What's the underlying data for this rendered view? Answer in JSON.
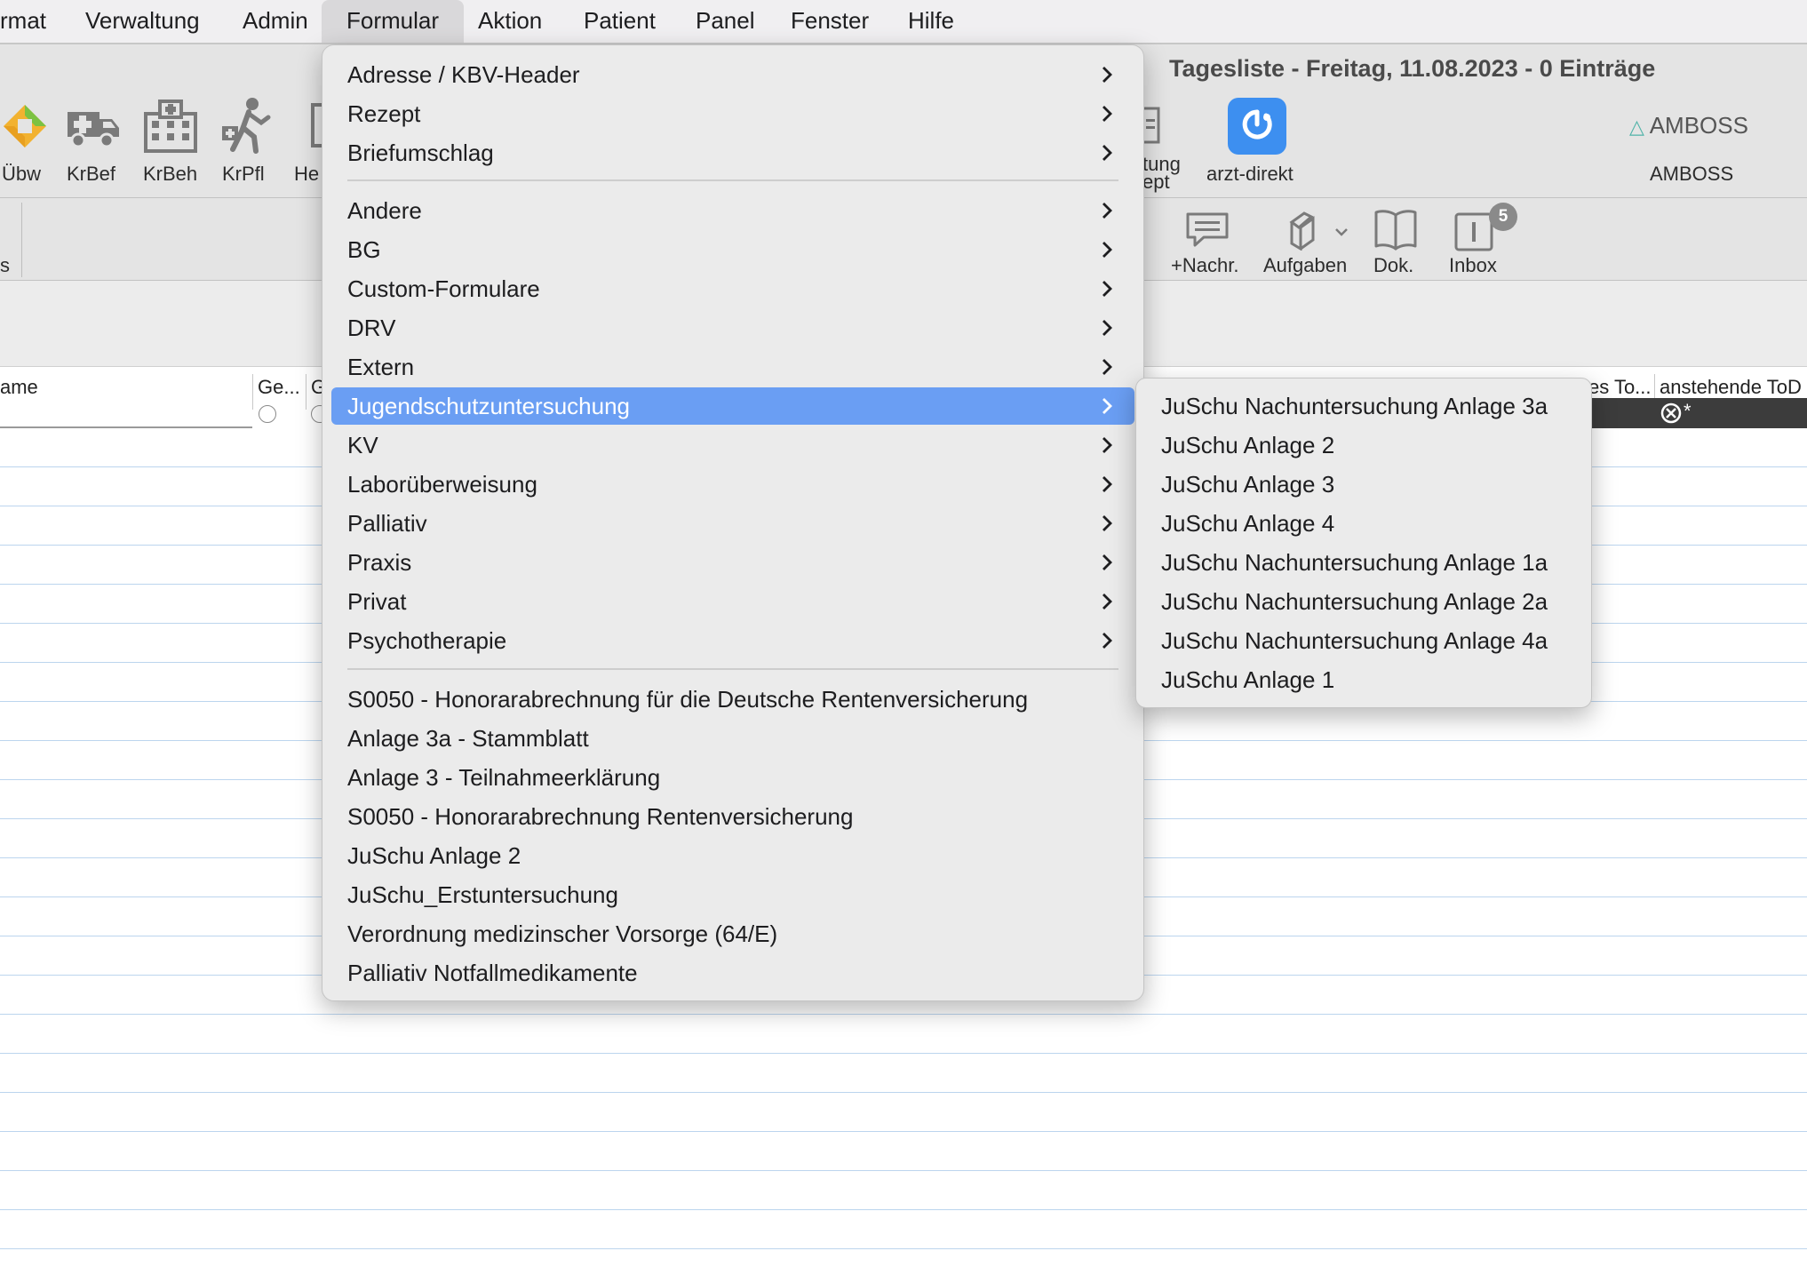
{
  "menubar": {
    "items": [
      "rmat",
      "Verwaltung",
      "Admin",
      "Formular",
      "Aktion",
      "Patient",
      "Panel",
      "Fenster",
      "Hilfe"
    ],
    "active": "Formular"
  },
  "window": {
    "title": "Tagesliste - Freitag, 11.08.2023 - 0 Einträge"
  },
  "toolbar": {
    "left_buttons": [
      "Übw",
      "KrBef",
      "KrBeh",
      "KrPfl",
      "He"
    ],
    "partial_label_1": "tung",
    "partial_label_2": "ept",
    "arzt_direkt": "arzt-direkt",
    "amboss_logo": "AMBOSS",
    "amboss_label": "AMBOSS",
    "row2_left": "s",
    "nachr": "+Nachr.",
    "aufgaben": "Aufgaben",
    "dok": "Dok.",
    "inbox": "Inbox",
    "inbox_badge": "5"
  },
  "table": {
    "headers": [
      "ame",
      "Ge...",
      "G",
      "es To...",
      "anstehende ToD"
    ],
    "todo_cell": "*"
  },
  "formular_menu": {
    "group1": [
      "Adresse / KBV-Header",
      "Rezept",
      "Briefumschlag"
    ],
    "group2": [
      "Andere",
      "BG",
      "Custom-Formulare",
      "DRV",
      "Extern",
      "Jugendschutzuntersuchung",
      "KV",
      "Laborüberweisung",
      "Palliativ",
      "Praxis",
      "Privat",
      "Psychotherapie"
    ],
    "highlighted": "Jugendschutzuntersuchung",
    "group3": [
      "S0050 - Honorarabrechnung für die Deutsche Rentenversicherung",
      "Anlage 3a - Stammblatt",
      "Anlage 3 - Teilnahmeerklärung",
      "S0050 - Honorarabrechnung Rentenversicherung",
      "JuSchu Anlage 2",
      "JuSchu_Erstuntersuchung",
      "Verordnung medizinscher Vorsorge (64/E)",
      "Palliativ Notfallmedikamente"
    ]
  },
  "submenu": {
    "items": [
      "JuSchu Nachuntersuchung Anlage 3a",
      "JuSchu Anlage 2",
      "JuSchu Anlage 3",
      "JuSchu Anlage 4",
      "JuSchu Nachuntersuchung Anlage 1a",
      "JuSchu Nachuntersuchung Anlage 2a",
      "JuSchu Nachuntersuchung Anlage 4a",
      "JuSchu Anlage 1"
    ]
  },
  "colors": {
    "highlight": "#6a9ef3",
    "arzt_direkt_icon": "#3d8ff0",
    "amboss_accent": "#4fb3a8",
    "row_lines": "#bcd5ee"
  },
  "icons": [
    "overview-icon",
    "ambulance-icon",
    "hospital-icon",
    "walking-patient-icon",
    "document-icon",
    "stethoscope-icon",
    "message-icon",
    "tasks-icon",
    "book-icon",
    "inbox-icon"
  ]
}
